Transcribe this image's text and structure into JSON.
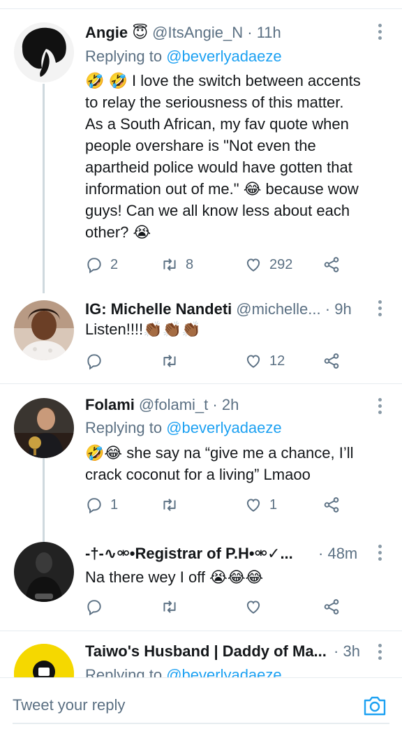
{
  "tweets": [
    {
      "name": "Angie 😇",
      "handle": "@ItsAngie_N",
      "time": "11h",
      "replying_label": "Replying to",
      "replying_to": "@beverlyadaeze",
      "text_lines": [
        "🤣 🤣 I love the switch between accents",
        "to relay the seriousness of this matter.",
        "As a South African, my fav quote when",
        "people overshare is \"Not even the",
        "apartheid police would have gotten that",
        "information out of me.\" 😂 because wow",
        "guys! Can we all know less about each",
        "other? 😭"
      ],
      "replies": "2",
      "retweets": "8",
      "likes": "292"
    },
    {
      "name": "IG: Michelle Nandeti",
      "handle": "@michelle...",
      "time": "9h",
      "text_lines": [
        "Listen!!!!👏🏾👏🏾👏🏾"
      ],
      "replies": "",
      "retweets": "",
      "likes": "12"
    },
    {
      "name": "Folami",
      "handle": "@folami_t",
      "time": "2h",
      "replying_label": "Replying to",
      "replying_to": "@beverlyadaeze",
      "text_lines": [
        "🤣😂 she say na “give me a chance, I’ll",
        "crack coconut for a living” Lmaoo"
      ],
      "replies": "1",
      "retweets": "",
      "likes": "1"
    },
    {
      "name": "-†-∿⚮•Registrar of P.H•⚮✓...",
      "handle": "",
      "time": "48m",
      "text_lines": [
        "Na there wey I off 😭😂😂"
      ],
      "replies": "",
      "retweets": "",
      "likes": ""
    },
    {
      "name": "Taiwo's Husband | Daddy of Ma...",
      "handle": "",
      "time": "3h",
      "replying_label": "Replying to",
      "replying_to": "@beverlyadaeze"
    }
  ],
  "composer": {
    "placeholder": "Tweet your reply"
  },
  "icons": {
    "reply": "reply-icon",
    "retweet": "retweet-icon",
    "like": "heart-icon",
    "share": "share-icon",
    "more": "more-vertical-icon",
    "camera": "camera-icon"
  },
  "colors": {
    "link": "#1da1f2",
    "secondary_text": "#5b7083",
    "divider": "#e6ecf0"
  }
}
